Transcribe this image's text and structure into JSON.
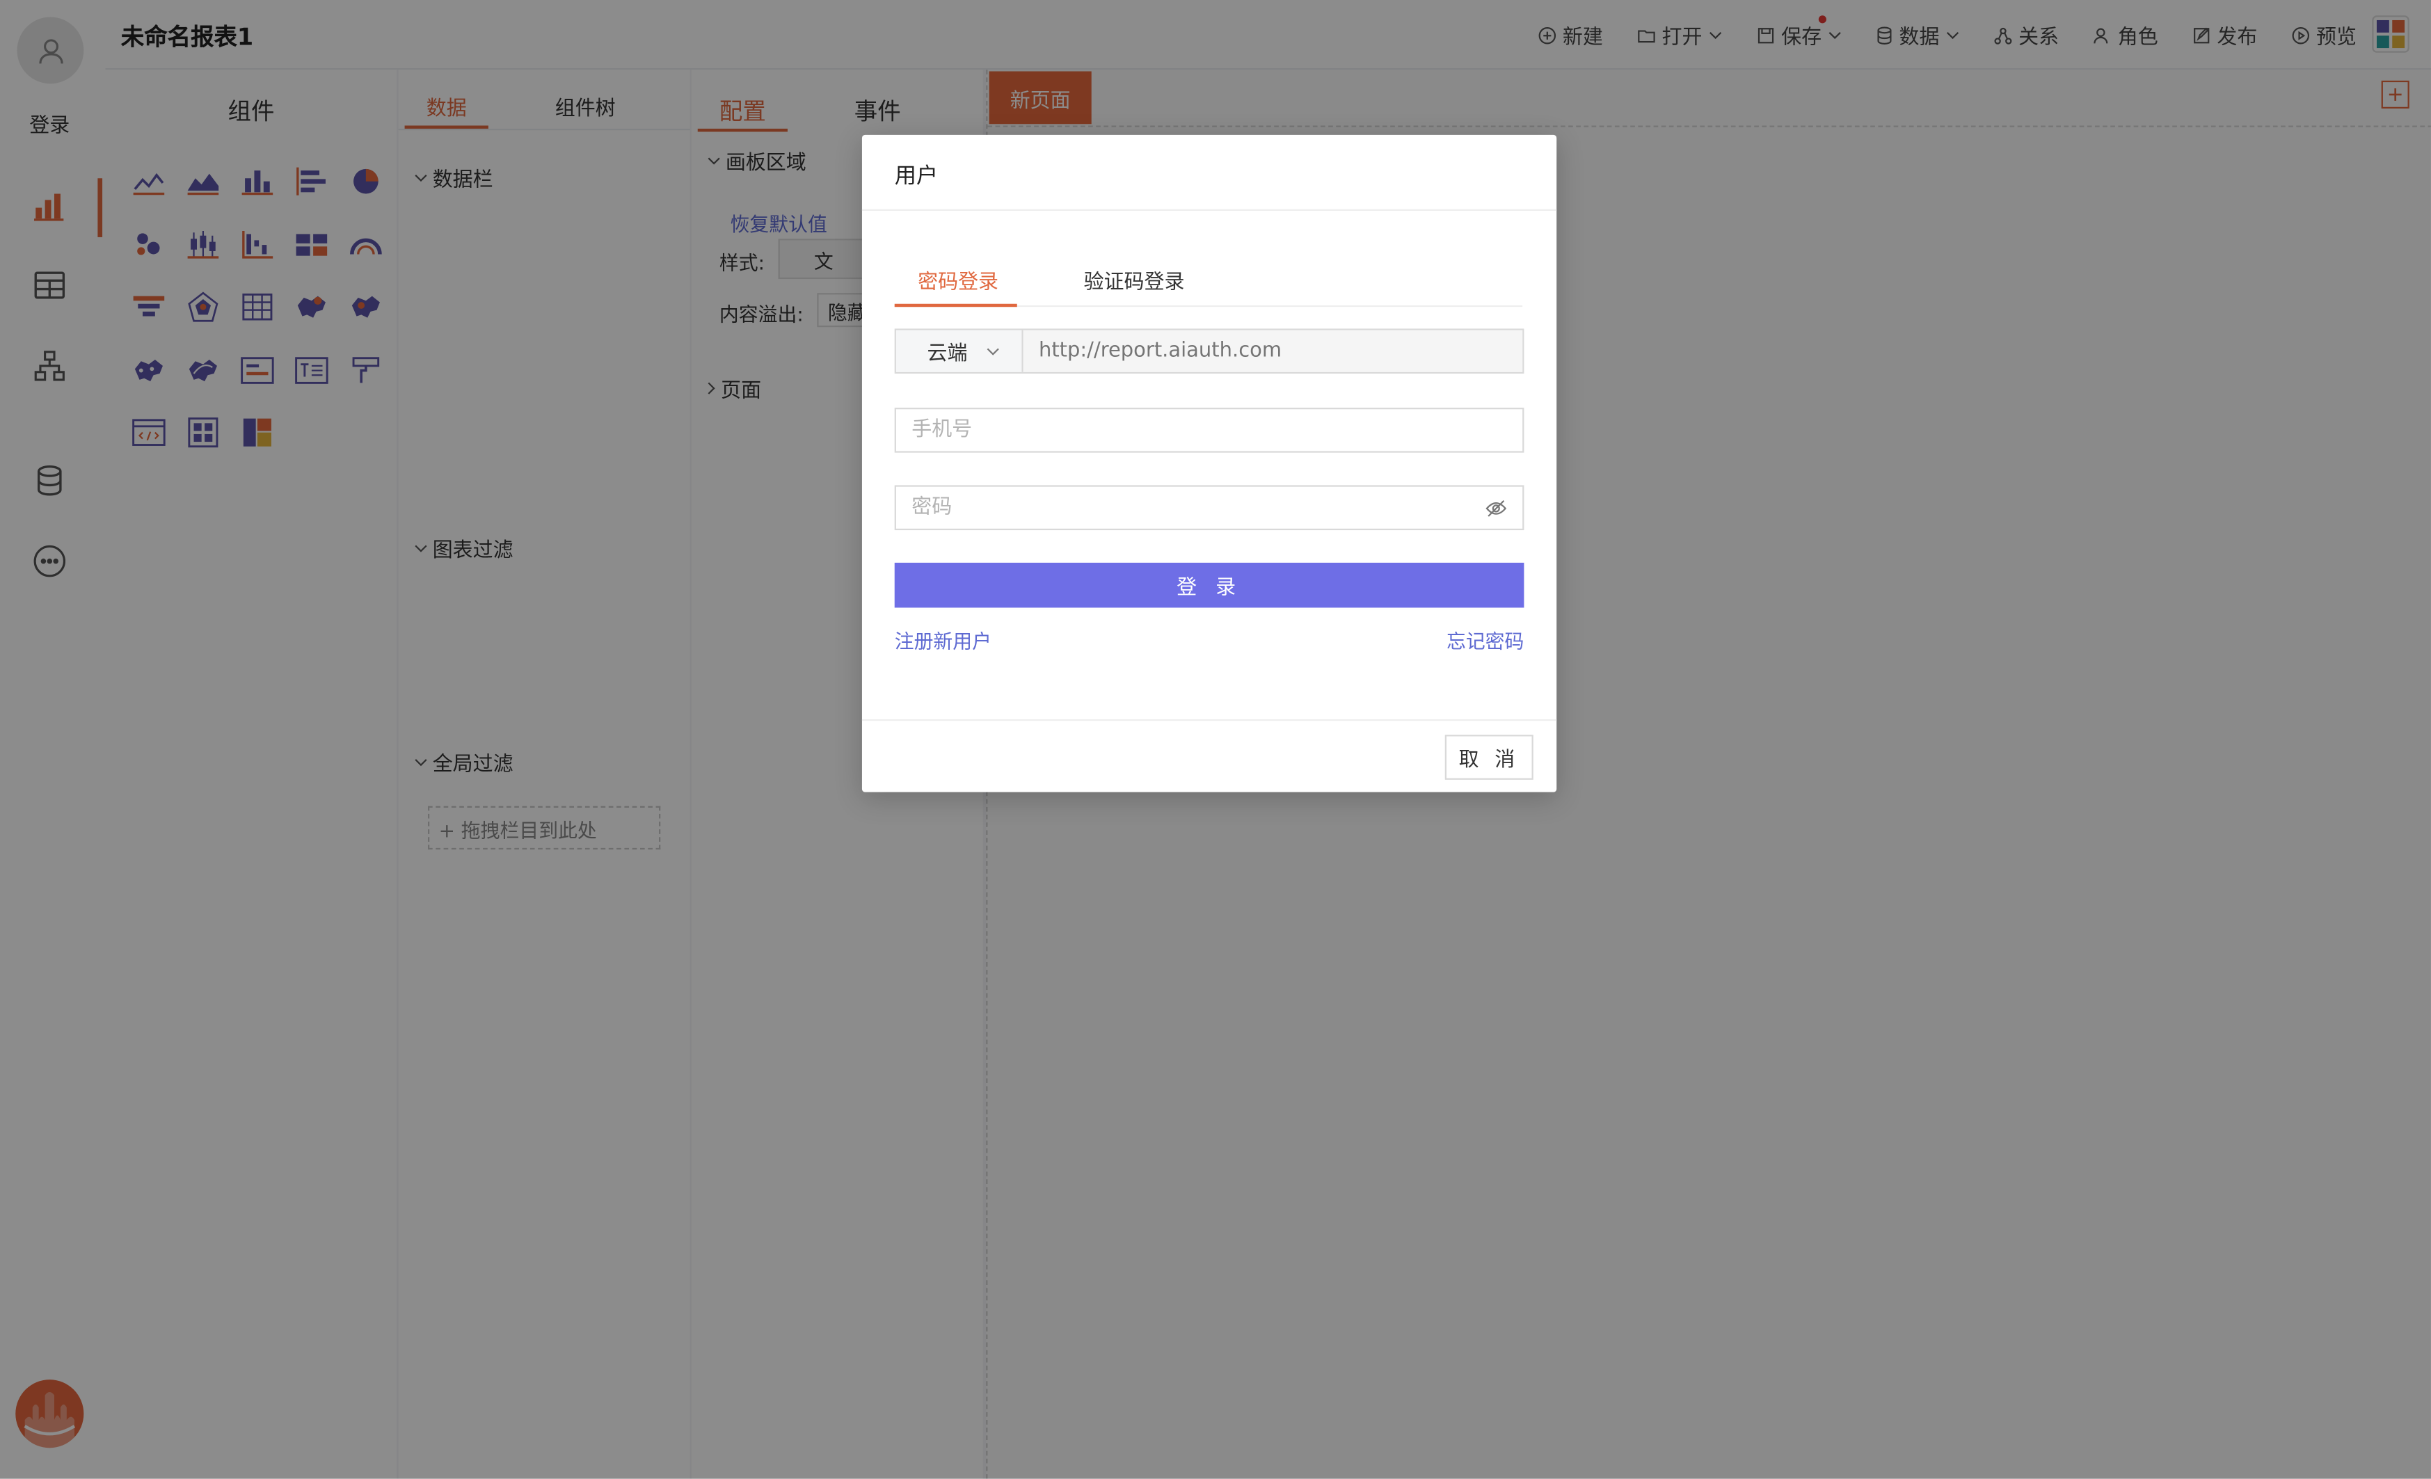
{
  "sidebar": {
    "login_label": "登录",
    "items": [
      {
        "icon": "bar-chart-icon",
        "active": true
      },
      {
        "icon": "table-icon",
        "active": false
      },
      {
        "icon": "structure-icon",
        "active": false
      },
      {
        "icon": "database-icon",
        "active": false
      },
      {
        "icon": "more-icon",
        "active": false
      }
    ]
  },
  "header": {
    "title": "未命名报表1",
    "toolbar": {
      "new": "新建",
      "open": "打开",
      "save": "保存",
      "data": "数据",
      "relation": "关系",
      "role": "角色",
      "publish": "发布",
      "preview": "预览"
    }
  },
  "component_panel": {
    "title": "组件"
  },
  "data_panel": {
    "tabs": [
      "数据",
      "组件树"
    ],
    "active_tab": "数据",
    "sections": {
      "data_bar": "数据栏",
      "chart_filter": "图表过滤",
      "global_filter": "全局过滤"
    },
    "drop_hint": "+ 拖拽栏目到此处"
  },
  "config_panel": {
    "tabs": [
      "配置",
      "事件"
    ],
    "active_tab": "配置",
    "canvas_region": "画板区域",
    "restore_default": "恢复默认值",
    "style_label": "样式:",
    "style_value": "文",
    "overflow_label": "内容溢出:",
    "overflow_value": "隐藏",
    "page_section": "页面"
  },
  "canvas": {
    "page_tab": "新页面"
  },
  "login_modal": {
    "title": "用户",
    "tabs": [
      "密码登录",
      "验证码登录"
    ],
    "active_tab": "密码登录",
    "server_select": "云端",
    "server_url_placeholder": "http://report.aiauth.com",
    "phone_placeholder": "手机号",
    "password_placeholder": "密码",
    "login_button": "登 录",
    "register_link": "注册新用户",
    "forgot_link": "忘记密码",
    "cancel_button": "取 消"
  },
  "colors": {
    "accent": "#e0683f",
    "primary_button": "#6e6ee6",
    "link": "#5e6ad2",
    "icon_purple": "#5b55a8",
    "icon_orange": "#e5683d"
  }
}
